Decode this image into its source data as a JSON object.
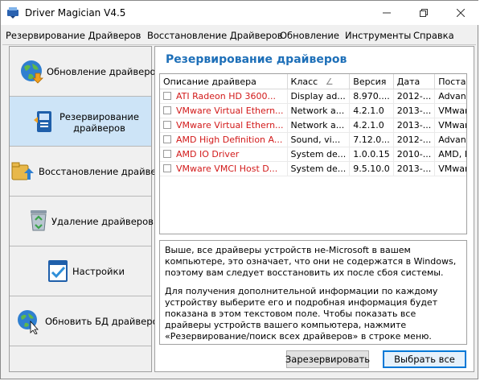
{
  "window": {
    "title": "Driver Magician V4.5"
  },
  "menu": [
    "Резервирование Драйверов",
    "Восстановление Драйверов",
    "Обновление",
    "Инструменты",
    "Справка"
  ],
  "sidebar": [
    {
      "label": "Обновление драйверов",
      "icon": "globe-update-icon"
    },
    {
      "label_line1": "Резервирование",
      "label_line2": "драйверов",
      "icon": "backup-icon",
      "active": true
    },
    {
      "label": "Восстановление драйверов",
      "icon": "restore-icon"
    },
    {
      "label": "Удаление драйверов",
      "icon": "recycle-bin-icon"
    },
    {
      "label": "Настройки",
      "icon": "settings-checklist-icon"
    },
    {
      "label": "Обновить БД драйверов",
      "icon": "globe-cursor-icon"
    }
  ],
  "main": {
    "title": "Резервирование драйверов",
    "columns": [
      "Описание драйвера",
      "Класс",
      "Версия",
      "Дата",
      "Поставщик"
    ],
    "sort_glyph": "∠",
    "rows": [
      [
        "ATI Radeon HD 3600...",
        "Display ad...",
        "8.970....",
        "2012-...",
        "Advanced..."
      ],
      [
        "VMware Virtual Ethern...",
        "Network a...",
        "4.2.1.0",
        "2013-...",
        "VMware, I..."
      ],
      [
        "VMware Virtual Ethern...",
        "Network a...",
        "4.2.1.0",
        "2013-...",
        "VMware, I..."
      ],
      [
        "AMD High Definition A...",
        "Sound, vi...",
        "7.12.0...",
        "2012-...",
        "Advanced..."
      ],
      [
        "AMD IO Driver",
        "System de...",
        "1.0.0.15",
        "2010-...",
        "AMD, Inc"
      ],
      [
        "VMware VMCI Host D...",
        "System de...",
        "9.5.10.0",
        "2013-...",
        "VMware, I..."
      ]
    ],
    "description_p1": "Выше, все драйверы устройств не-Microsoft в вашем компьютере, это означает, что они не содержатся в Windows, поэтому вам следует восстановить их после сбоя системы.",
    "description_p2": "Для получения дополнительной информации по каждому устройству выберите его и подробная информация будет показана в этом текстовом поле. Чтобы показать все драйверы устройств вашего компьютера, нажмите «Резервирование/поиск всех драйверов» в строке меню.",
    "btn_backup": "Зарезервировать",
    "btn_select_all": "Выбрать все"
  },
  "colors": {
    "accent": "#1d6fb8",
    "driver_text": "#d21a1a",
    "active_item": "#cde4f7"
  }
}
